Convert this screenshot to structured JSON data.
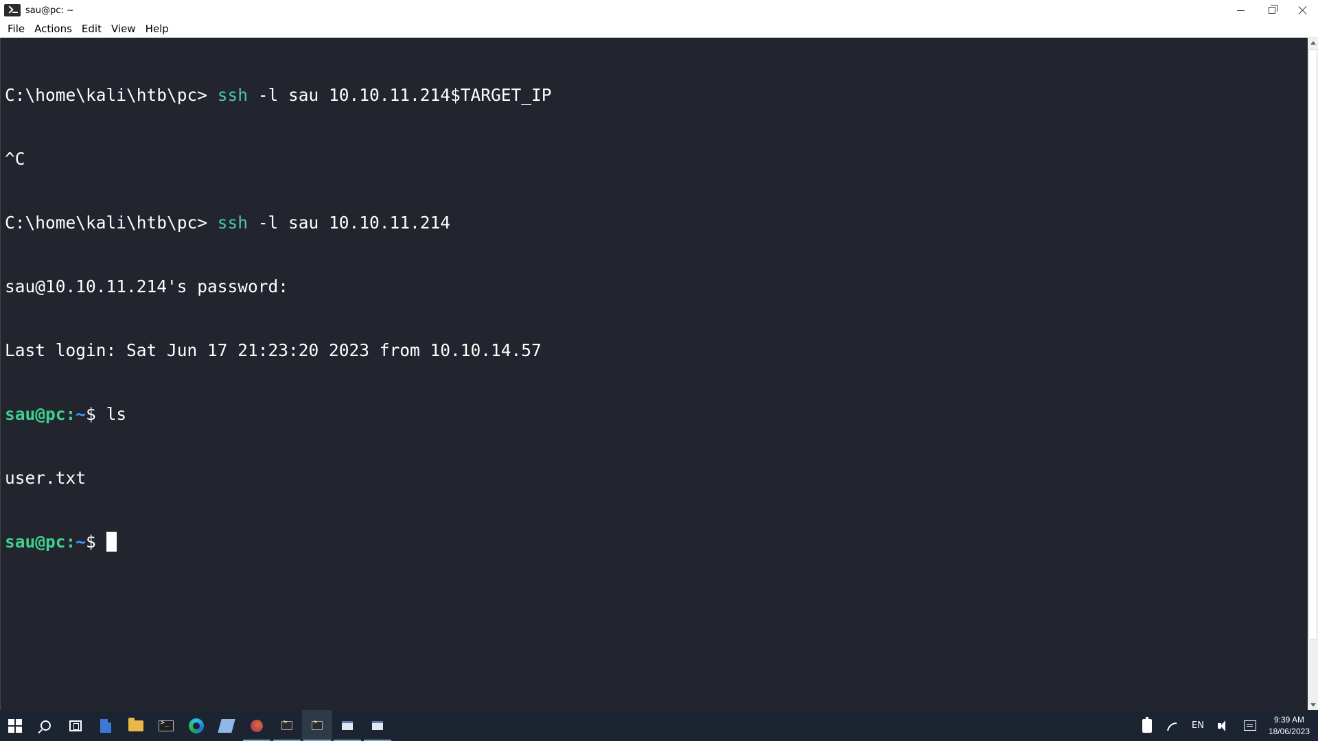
{
  "window": {
    "title": "sau@pc: ~",
    "icon": "terminal-icon"
  },
  "menu": {
    "items": [
      "File",
      "Actions",
      "Edit",
      "View",
      "Help"
    ]
  },
  "terminal": {
    "lines": [
      {
        "prompt": "C:\\home\\kali\\htb\\pc> ",
        "cmd": "ssh",
        "args": " -l sau 10.10.11.214$TARGET_IP"
      },
      {
        "text": "^C"
      },
      {
        "prompt": "C:\\home\\kali\\htb\\pc> ",
        "cmd": "ssh",
        "args": " -l sau 10.10.11.214"
      },
      {
        "text": "sau@10.10.11.214's password:"
      },
      {
        "text": "Last login: Sat Jun 17 21:23:20 2023 from 10.10.14.57"
      },
      {
        "user": "sau@pc",
        "sep": ":",
        "path": "~",
        "dollar": "$ ",
        "input": "ls"
      },
      {
        "text": "user.txt"
      },
      {
        "user": "sau@pc",
        "sep": ":",
        "path": "~",
        "dollar": "$ ",
        "input": ""
      }
    ],
    "colors": {
      "background": "#22252d",
      "foreground": "#ffffff",
      "command": "#4ec9a4",
      "prompt_user": "#3ed08e",
      "prompt_path": "#3d9bff"
    }
  },
  "taskbar": {
    "icons": [
      "windows-start-icon",
      "search-icon",
      "task-view-icon",
      "file-icon",
      "folder-icon",
      "terminal-icon",
      "edge-icon",
      "notes-icon",
      "firefox-icon",
      "terminal-icon",
      "terminal-icon",
      "window-icon",
      "window-icon"
    ],
    "tray": {
      "language": "EN",
      "time": "9:39 AM",
      "date": "18/06/2023"
    }
  }
}
